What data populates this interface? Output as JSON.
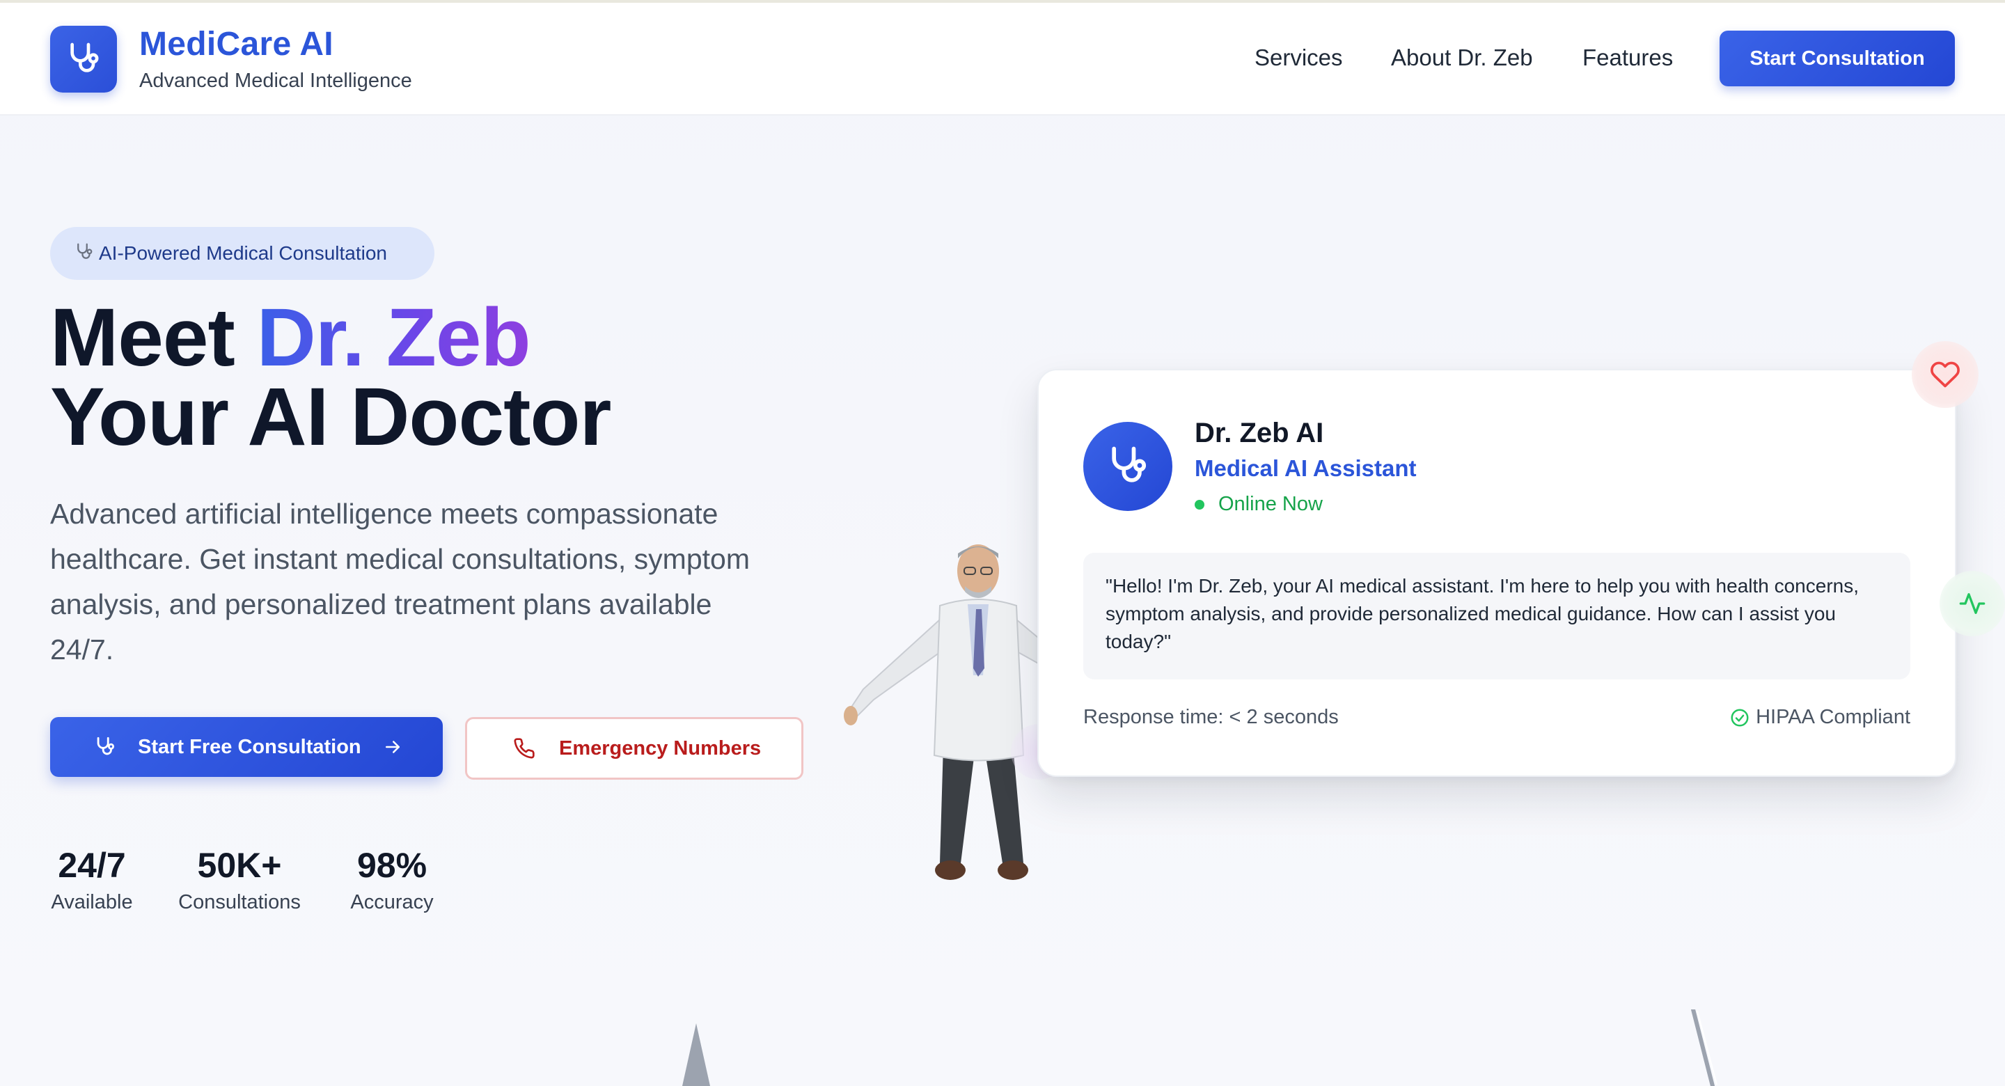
{
  "header": {
    "brand_title": "MediCare AI",
    "brand_subtitle": "Advanced Medical Intelligence",
    "nav": [
      {
        "label": "Services"
      },
      {
        "label": "About Dr. Zeb"
      },
      {
        "label": "Features"
      }
    ],
    "cta_label": "Start Consultation"
  },
  "hero": {
    "badge": "AI-Powered Medical Consultation",
    "headline_prefix": "Meet ",
    "headline_accent": "Dr. Zeb",
    "headline_line2": "Your AI Doctor",
    "description": "Advanced artificial intelligence meets compassionate healthcare. Get instant medical consultations, symptom analysis, and personalized treatment plans available 24/7.",
    "primary_button": "Start Free Consultation",
    "secondary_button": "Emergency Numbers",
    "stats": [
      {
        "value": "24/7",
        "label": "Available"
      },
      {
        "value": "50K+",
        "label": "Consultations"
      },
      {
        "value": "98%",
        "label": "Accuracy"
      }
    ]
  },
  "card": {
    "name": "Dr. Zeb AI",
    "role": "Medical AI Assistant",
    "status": "Online Now",
    "message": "\"Hello! I'm Dr. Zeb, your AI medical assistant. I'm here to help you with health concerns, symptom analysis, and provide personalized medical guidance. How can I assist you today?\"",
    "response_time": "Response time: < 2 seconds",
    "compliance": "HIPAA Compliant"
  },
  "icons": {
    "logo": "stethoscope-icon",
    "badge": "stethoscope-icon",
    "primary_button_left": "stethoscope-icon",
    "primary_button_right": "arrow-right-icon",
    "secondary_button": "phone-icon",
    "compliance": "check-circle-icon",
    "float_1": "heart-icon",
    "float_2": "activity-icon"
  },
  "colors": {
    "brand": "#2b55d9",
    "primary_button": "#2f55df",
    "emergency": "#b91c1c",
    "online": "#16a34a",
    "headline_accent_start": "#3b5fe8",
    "headline_accent_end": "#8e3fe0"
  }
}
